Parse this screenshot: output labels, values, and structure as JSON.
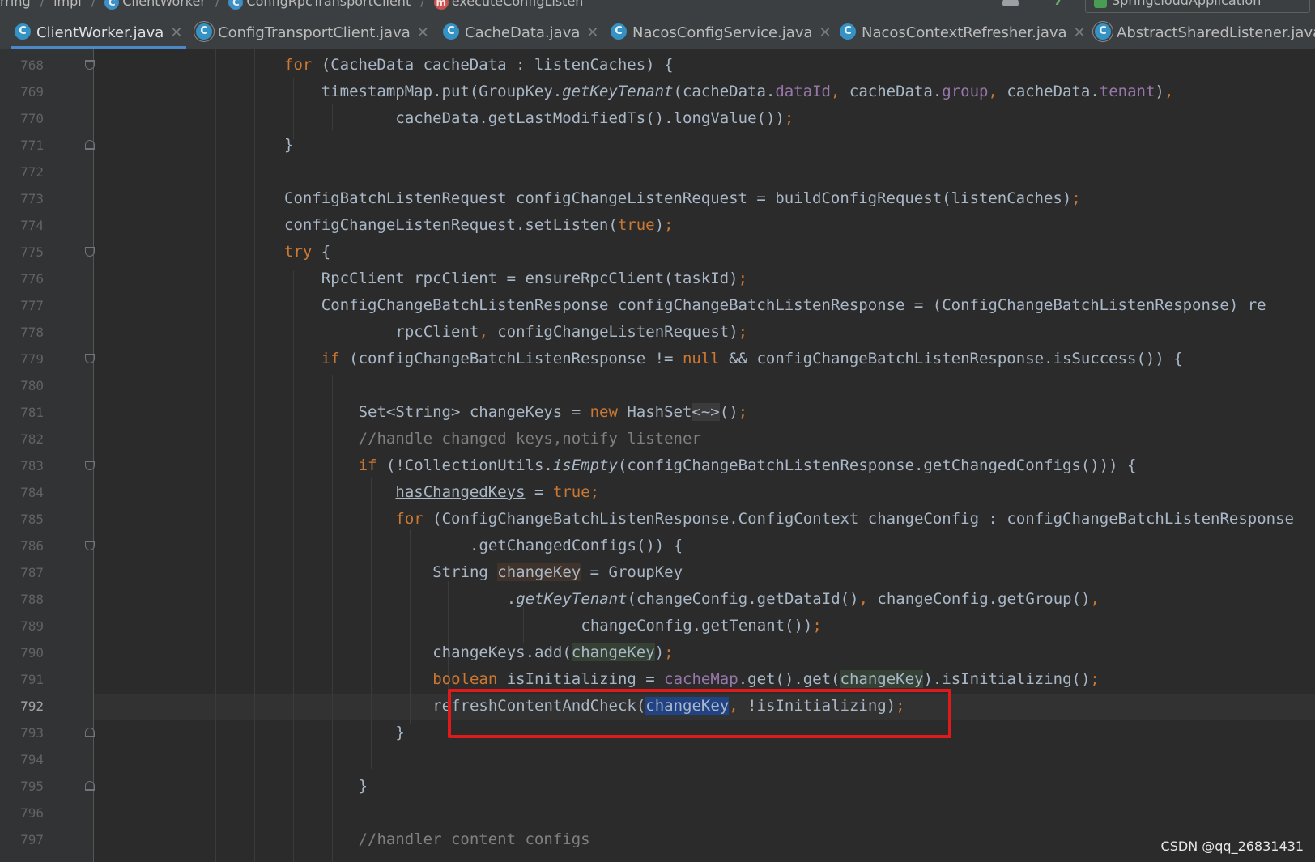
{
  "breadcrumb": {
    "items": [
      "rring",
      "impl",
      "ClientWorker",
      "ConfigRpcTransportClient",
      "executeConfigListen"
    ],
    "run_config": "SpringcloudApplication"
  },
  "tabs": [
    {
      "label": "ClientWorker.java",
      "active": true,
      "icon": "class-icon"
    },
    {
      "label": "ConfigTransportClient.java",
      "active": false,
      "icon": "abstract-class-icon"
    },
    {
      "label": "CacheData.java",
      "active": false,
      "icon": "class-icon"
    },
    {
      "label": "NacosConfigService.java",
      "active": false,
      "icon": "class-icon"
    },
    {
      "label": "NacosContextRefresher.java",
      "active": false,
      "icon": "class-icon"
    },
    {
      "label": "AbstractSharedListener.java",
      "active": false,
      "icon": "abstract-class-icon"
    }
  ],
  "editor": {
    "current_line": "792",
    "line_numbers": [
      "768",
      "769",
      "770",
      "771",
      "772",
      "773",
      "774",
      "775",
      "776",
      "777",
      "778",
      "779",
      "780",
      "781",
      "782",
      "783",
      "784",
      "785",
      "786",
      "787",
      "788",
      "789",
      "790",
      "791",
      "792",
      "793",
      "794",
      "795",
      "796",
      "797"
    ],
    "lines": [
      "for (CacheData cacheData : listenCaches) {",
      "timestampMap.put(GroupKey.getKeyTenant(cacheData.dataId, cacheData.group, cacheData.tenant),",
      "cacheData.getLastModifiedTs().longValue());",
      "}",
      "",
      "ConfigBatchListenRequest configChangeListenRequest = buildConfigRequest(listenCaches);",
      "configChangeListenRequest.setListen(true);",
      "try {",
      "RpcClient rpcClient = ensureRpcClient(taskId);",
      "ConfigChangeBatchListenResponse configChangeBatchListenResponse = (ConfigChangeBatchListenResponse) re",
      "rpcClient, configChangeListenRequest);",
      "if (configChangeBatchListenResponse != null && configChangeBatchListenResponse.isSuccess()) {",
      "",
      "Set<String> changeKeys = new HashSet<~>();",
      "//handle changed keys,notify listener",
      "if (!CollectionUtils.isEmpty(configChangeBatchListenResponse.getChangedConfigs())) {",
      "hasChangedKeys = true;",
      "for (ConfigChangeBatchListenResponse.ConfigContext changeConfig : configChangeBatchListenResponse",
      ".getChangedConfigs()) {",
      "String changeKey = GroupKey",
      ".getKeyTenant(changeConfig.getDataId(), changeConfig.getGroup(),",
      "changeConfig.getTenant());",
      "changeKeys.add(changeKey);",
      "boolean isInitializing = cacheMap.get().get(changeKey).isInitializing();",
      "refreshContentAndCheck(changeKey, !isInitializing);",
      "}",
      "",
      "}",
      "",
      "//handler content configs"
    ]
  },
  "watermark": "CSDN @qq_26831431"
}
